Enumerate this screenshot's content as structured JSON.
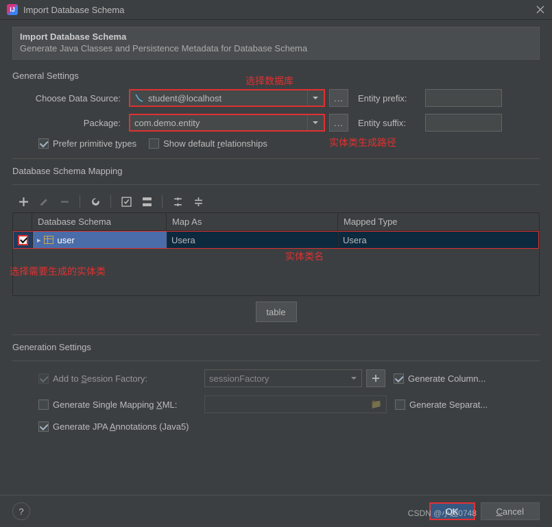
{
  "window": {
    "title": "Import Database Schema"
  },
  "banner": {
    "title": "Import Database Schema",
    "desc": "Generate Java Classes and Persistence Metadata for Database Schema"
  },
  "sections": {
    "general": "General Settings",
    "mapping": "Database Schema Mapping",
    "generation": "Generation Settings"
  },
  "labels": {
    "chooseDataSource": "Choose Data Source:",
    "package": "Package:",
    "entityPrefix": "Entity prefix:",
    "entitySuffix": "Entity suffix:",
    "preferPrimitive_pre": "Prefer primitive ",
    "preferPrimitive_u": "t",
    "preferPrimitive_post": "ypes",
    "showDefaultRel_pre": "Show default ",
    "showDefaultRel_u": "r",
    "showDefaultRel_post": "elationships",
    "addToSession_pre": "Add to ",
    "addToSession_u": "S",
    "addToSession_post": "ession Factory:",
    "genSingle_pre": "Generate Single Mapping ",
    "genSingle_u": "X",
    "genSingle_post": "ML:",
    "genJpa_pre": "Generate JPA ",
    "genJpa_u": "A",
    "genJpa_post": "nnotations (Java5)",
    "genColumn": "Generate Column...",
    "genSeparate": "Generate Separat..."
  },
  "values": {
    "dataSource": "student@localhost",
    "package": "com.demo.entity",
    "sessionFactory": "sessionFactory",
    "entityPrefix": "",
    "entitySuffix": ""
  },
  "tableHeaders": {
    "schema": "Database Schema",
    "mapAs": "Map As",
    "mappedType": "Mapped Type"
  },
  "rows": [
    {
      "name": "user",
      "mapAs": "Usera",
      "mappedType": "Usera"
    }
  ],
  "tableBtn": "table",
  "buttons": {
    "ok": "OK",
    "cancel_pre": "",
    "cancel_u": "C",
    "cancel_post": "ancel",
    "browse": "...",
    "help": "?"
  },
  "annotations": {
    "chooseDb": "选择数据库",
    "entityPath": "实体类生成路径",
    "entityName": "实体类名",
    "selectEntity": "选择需要生成的实体类"
  },
  "watermark": "CSDN @小超0748"
}
